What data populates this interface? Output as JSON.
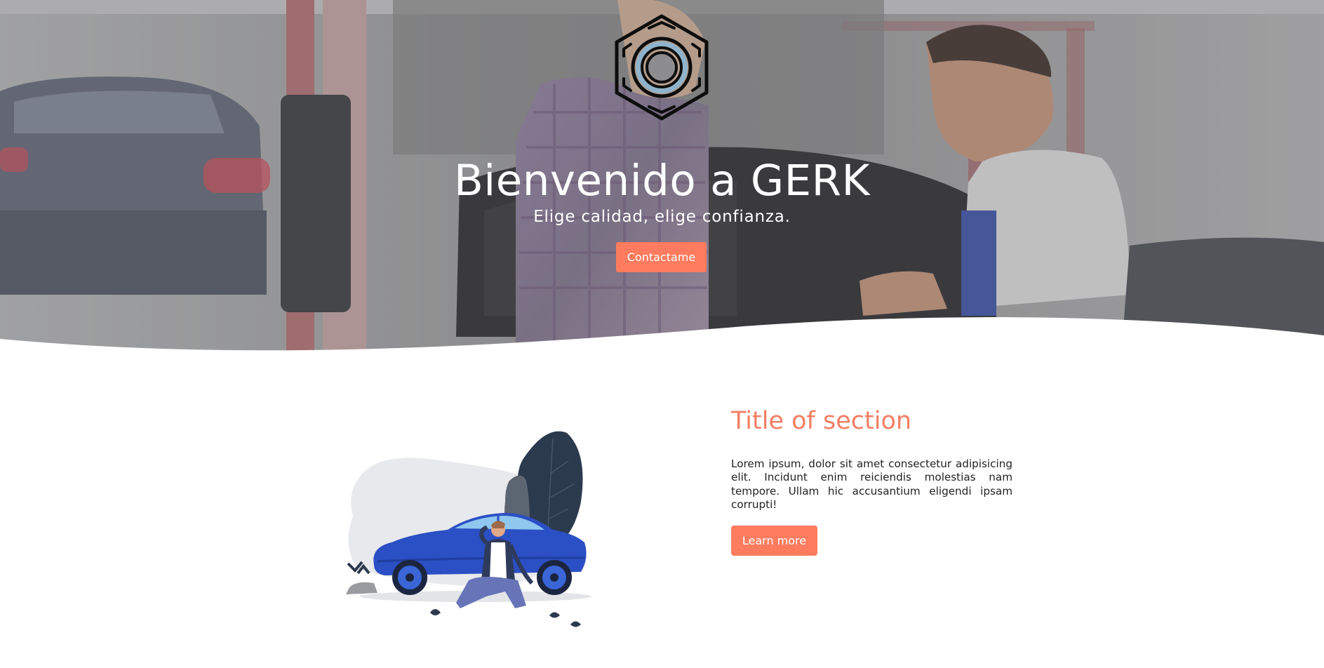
{
  "hero": {
    "title": "Bienvenido a GERK",
    "subtitle": "Elige calidad, elige confianza.",
    "cta_label": "Contactame",
    "logo_icon": "hex-nut-icon"
  },
  "section": {
    "title": "Title of section",
    "text": "Lorem ipsum, dolor sit amet consectetur adipisicing elit. Incidunt enim reiciendis molestias nam tempore. Ullam hic accusantium eligendi ipsam corrupti!",
    "button_label": "Learn more",
    "illustration_icon": "broken-car-illustration"
  },
  "colors": {
    "accent": "#fd7b5e",
    "section_title": "#f47e63",
    "nut_ring": "#8fb3cc",
    "car_blue": "#2b4fc4",
    "leaf_dark": "#2c3a4e"
  }
}
